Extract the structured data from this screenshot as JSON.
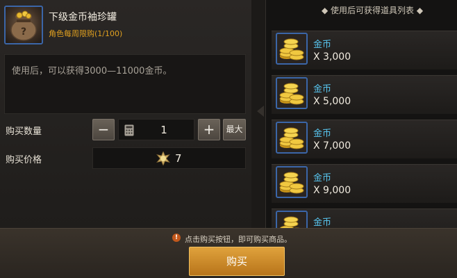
{
  "item": {
    "name": "下级金币袖珍罐",
    "limit": "角色每周限购(1/100)",
    "icon": "coin-pouch-icon",
    "description": "使用后，可以获得3000—11000金币。"
  },
  "purchase": {
    "quantity_label": "购买数量",
    "minus": "−",
    "plus": "+",
    "max": "最大",
    "quantity": "1",
    "price_label": "购买价格",
    "price": "7",
    "currency_icon": "gem-currency-icon"
  },
  "reward_list": {
    "title": "◆ 使用后可获得道具列表 ◆",
    "items": [
      {
        "name": "金币",
        "quantity": "X 3,000"
      },
      {
        "name": "金币",
        "quantity": "X 5,000"
      },
      {
        "name": "金币",
        "quantity": "X 7,000"
      },
      {
        "name": "金币",
        "quantity": "X 9,000"
      },
      {
        "name": "金币",
        "quantity": ""
      }
    ]
  },
  "footer": {
    "hint": "点击购买按钮，即可购买商品。",
    "hint_icon": "!",
    "buy": "购买"
  },
  "colors": {
    "accent_gold": "#e0a23c",
    "limit_orange": "#e0a020",
    "reward_name_blue": "#58c6f0",
    "icon_border_blue": "#3b66a8"
  }
}
